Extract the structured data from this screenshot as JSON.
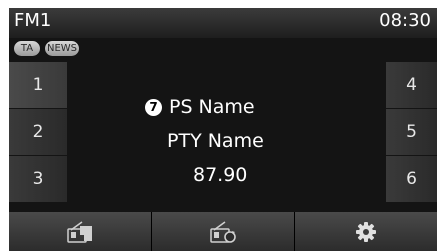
{
  "header": {
    "band": "FM1",
    "time": "08:30"
  },
  "badges": {
    "ta": "TA",
    "news": "NEWS"
  },
  "presets": {
    "left": [
      "1",
      "2",
      "3"
    ],
    "right": [
      "4",
      "5",
      "6"
    ]
  },
  "station": {
    "marker": "7",
    "ps_name": "PS Name",
    "pty_name": "PTY Name",
    "frequency": "87.90"
  },
  "bottom_buttons": [
    {
      "icon": "radio-list-icon"
    },
    {
      "icon": "radio-scan-icon"
    },
    {
      "icon": "gear-icon"
    }
  ]
}
